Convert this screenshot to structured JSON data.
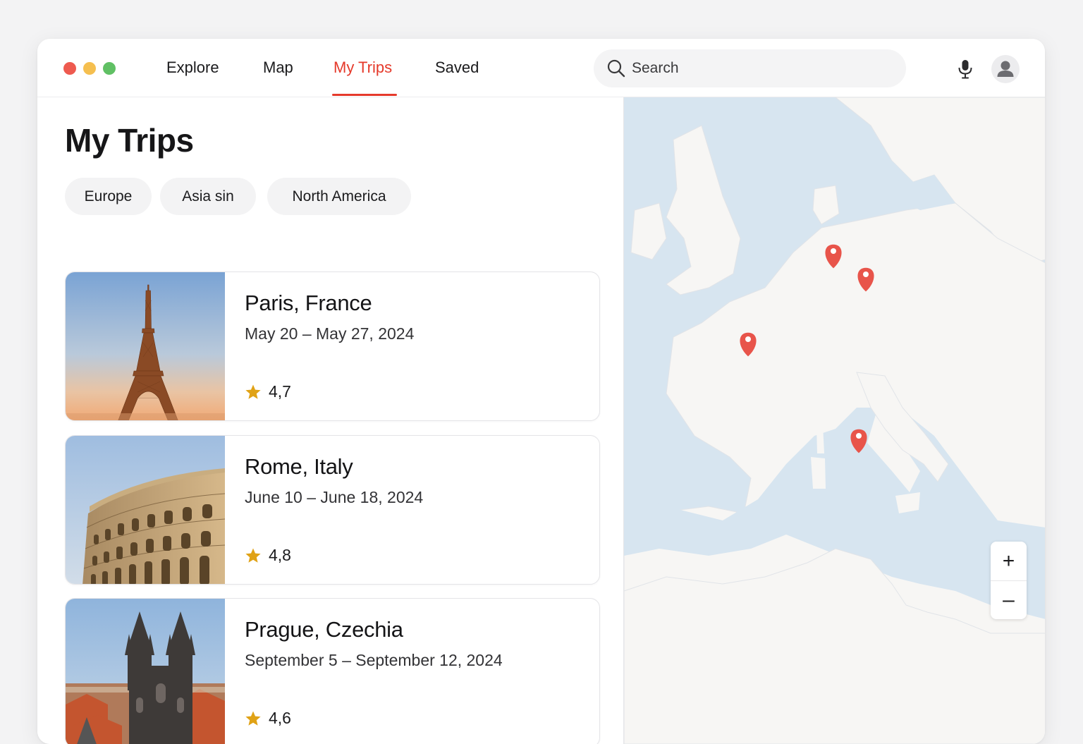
{
  "window": {
    "controls": [
      "close",
      "minimize",
      "zoom"
    ]
  },
  "nav": {
    "tabs": [
      {
        "label": "Explore",
        "active": false
      },
      {
        "label": "Map",
        "active": false
      },
      {
        "label": "My Trips",
        "active": true
      },
      {
        "label": "Saved",
        "active": false
      }
    ],
    "accent_color": "#e53a2b"
  },
  "search": {
    "placeholder": "Search",
    "value": ""
  },
  "header_icons": [
    "microphone-icon",
    "user-avatar-icon"
  ],
  "page": {
    "title": "My Trips",
    "filters": [
      "Europe",
      "Asia sin",
      "North America"
    ]
  },
  "trips": [
    {
      "city": "Paris, France",
      "dates": "May 20 – May 27, 2024",
      "rating": "4,7",
      "photo": "eiffel-tower-photo"
    },
    {
      "city": "Rome, Italy",
      "dates": "June 10 – June 18, 2024",
      "rating": "4,8",
      "photo": "colosseum-photo"
    },
    {
      "city": "Prague, Czechia",
      "dates": "September 5 – September 12, 2024",
      "rating": "4,6",
      "photo": "tyn-church-photo"
    }
  ],
  "map": {
    "region": "Europe",
    "pin_color": "#e8544a",
    "land_color": "#f7f6f4",
    "water_color": "#d7e5f0",
    "zoom": {
      "in_label": "+",
      "out_label": "–"
    }
  }
}
